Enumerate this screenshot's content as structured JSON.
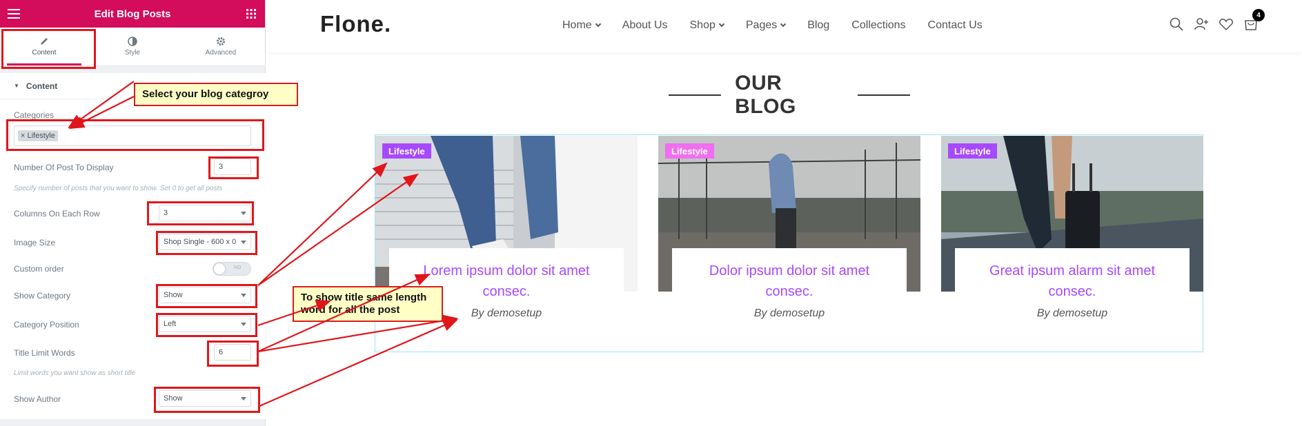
{
  "panel": {
    "title": "Edit Blog Posts",
    "tabs": [
      {
        "label": "Content",
        "icon": "pencil-icon",
        "active": true
      },
      {
        "label": "Style",
        "icon": "contrast-icon",
        "active": false
      },
      {
        "label": "Advanced",
        "icon": "gear-icon",
        "active": false
      }
    ],
    "section_title": "Content",
    "controls": {
      "categories_label": "Categories",
      "categories_chip": "Lifestyle",
      "num_posts_label": "Number Of Post To Display",
      "num_posts_value": "3",
      "num_posts_desc": "Specify number of posts that you want to show. Set 0 to get all posts",
      "columns_label": "Columns On Each Row",
      "columns_value": "3",
      "image_size_label": "Image Size",
      "image_size_value": "Shop Single - 600 x 0",
      "custom_order_label": "Custom order",
      "custom_order_toggle": "NO",
      "show_category_label": "Show Category",
      "show_category_value": "Show",
      "category_position_label": "Category Position",
      "category_position_value": "Left",
      "title_limit_label": "Title Limit Words",
      "title_limit_value": "6",
      "title_limit_desc": "Limit words you want show as short title",
      "show_author_label": "Show Author",
      "show_author_value": "Show"
    }
  },
  "site": {
    "logo": "Flone.",
    "menu": [
      {
        "label": "Home",
        "dropdown": true
      },
      {
        "label": "About Us",
        "dropdown": false
      },
      {
        "label": "Shop",
        "dropdown": true
      },
      {
        "label": "Pages",
        "dropdown": true
      },
      {
        "label": "Blog",
        "dropdown": false
      },
      {
        "label": "Collections",
        "dropdown": false
      },
      {
        "label": "Contact Us",
        "dropdown": false
      }
    ],
    "cart_count": "4",
    "section_title": "OUR BLOG",
    "posts": [
      {
        "badge": "Lifestyle",
        "badge_color": "#a749ff",
        "title": "Lorem ipsum dolor sit amet consec.",
        "author": "By demosetup"
      },
      {
        "badge": "Lifestyle",
        "badge_color": "#f06ef0",
        "title": "Dolor ipsum dolor sit amet consec.",
        "author": "By demosetup"
      },
      {
        "badge": "Lifestyle",
        "badge_color": "#a749ff",
        "title": "Great ipsum alarm sit amet consec.",
        "author": "By demosetup"
      }
    ]
  },
  "annotations": {
    "callout_category": "Select your blog categroy",
    "callout_title": "To show title same length word for all the post"
  },
  "colors": {
    "elementor_pink": "#d30c5c",
    "accent_purple": "#a749ff",
    "annotation_red": "#e0161b",
    "callout_yellow": "#ffffc6"
  }
}
